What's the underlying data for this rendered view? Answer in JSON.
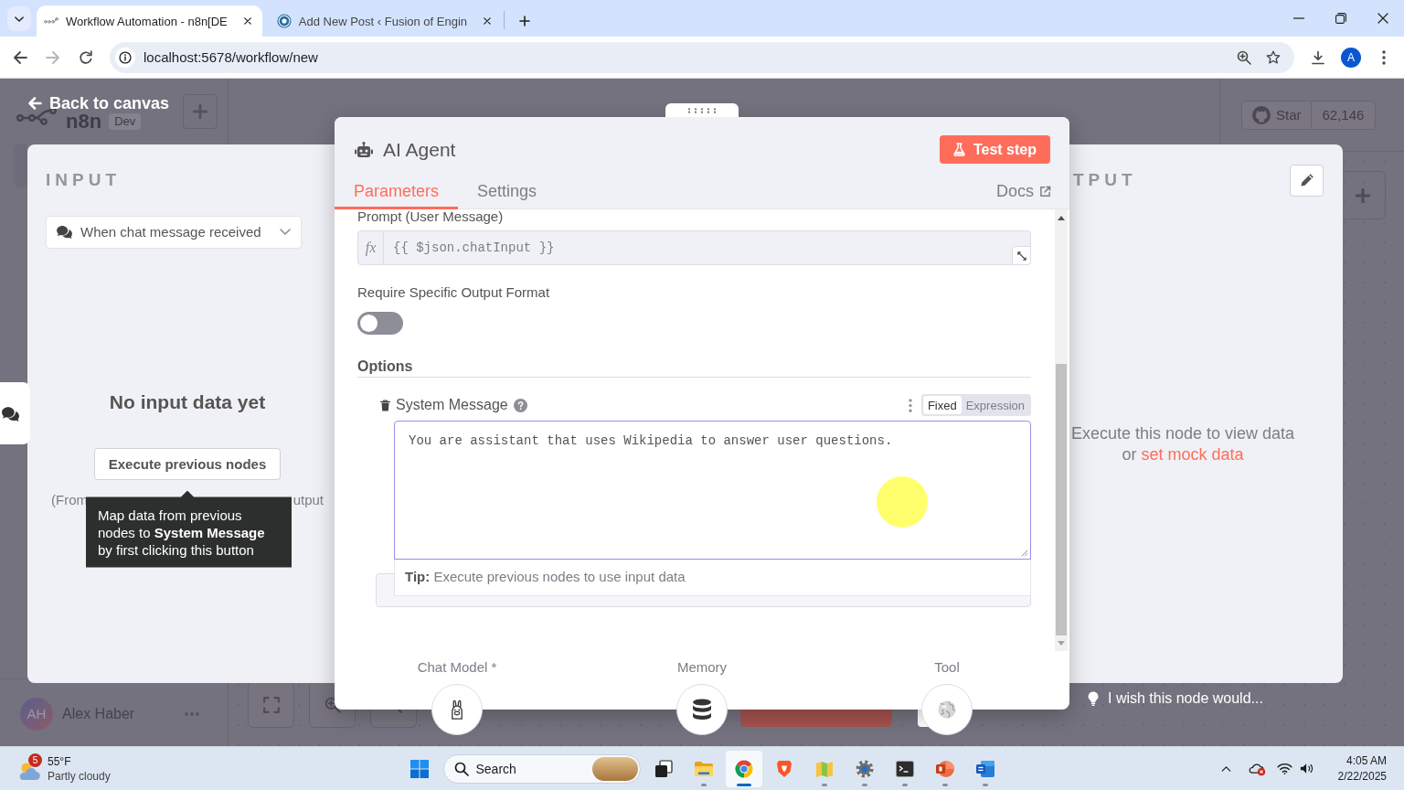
{
  "browser": {
    "tabs": [
      {
        "kind": "workflow",
        "title": "Workflow Automation - n8n[DE",
        "selected": true
      },
      {
        "kind": "site",
        "title": "Add New Post ‹ Fusion of Engin",
        "selected": false
      }
    ],
    "forward_disabled": true,
    "url": "localhost:5678/workflow/new",
    "profile": "A"
  },
  "canvas": {
    "logo": "n8n",
    "badge": "Dev",
    "star": {
      "label": "Star",
      "count": "62,146"
    },
    "user": {
      "initials": "AH",
      "name": "Alex Haber"
    }
  },
  "back_link": "Back to canvas",
  "input_panel": {
    "title": "INPUT",
    "source": "When chat message received",
    "empty_title": "No input data yet",
    "button": "Execute previous nodes",
    "hint": [
      "(From",
      "utput"
    ],
    "tooltip": "Map data from previous nodes to **System Message** by first clicking this button"
  },
  "node": {
    "title": "AI Agent",
    "test_button": "Test step",
    "tabs": [
      {
        "label": "Parameters",
        "selected": true
      },
      {
        "label": "Settings",
        "selected": false
      }
    ],
    "docs": "Docs",
    "parameters": [
      {
        "kind": "expression",
        "label": "Prompt (User Message)",
        "prefix": "fx",
        "value": "{{ $json.chatInput }}"
      },
      {
        "kind": "toggle",
        "label": "Require Specific Output Format",
        "on": false
      },
      {
        "kind": "section",
        "label": "Options"
      },
      {
        "kind": "option",
        "label": "System Message",
        "modes": [
          {
            "label": "Fixed",
            "selected": true
          },
          {
            "label": "Expression",
            "selected": false
          }
        ],
        "value": "You are assistant that uses Wikipedia to answer user questions.",
        "tip": "**Tip:** Execute previous nodes to use input data"
      }
    ],
    "connectors": [
      {
        "kind": "chat_model",
        "label": "Chat Model *"
      },
      {
        "kind": "memory",
        "label": "Memory"
      },
      {
        "kind": "tool",
        "label": "Tool"
      }
    ]
  },
  "output_panel": {
    "title": "TPUT",
    "message": "Execute this node to view data",
    "message_prefix": "or",
    "link": "set mock data"
  },
  "feedback": "I wish this node would...",
  "taskbar": {
    "weather": {
      "badge": "5",
      "temperature": "55°F",
      "condition": "Partly cloudy"
    },
    "search": {
      "label": "Search"
    },
    "apps": [
      {
        "kind": "task_view",
        "running": false,
        "selected": false
      },
      {
        "kind": "file_explorer",
        "running": true,
        "selected": false
      },
      {
        "kind": "chrome",
        "running": true,
        "selected": true
      },
      {
        "kind": "brave",
        "running": false,
        "selected": false
      },
      {
        "kind": "maps",
        "running": true,
        "selected": false
      },
      {
        "kind": "settings",
        "running": true,
        "selected": false
      },
      {
        "kind": "terminal",
        "running": true,
        "selected": false
      },
      {
        "kind": "powerpoint",
        "running": true,
        "selected": false
      },
      {
        "kind": "word",
        "running": true,
        "selected": false
      }
    ],
    "time": "4:05 AM",
    "date": "2/22/2025"
  }
}
